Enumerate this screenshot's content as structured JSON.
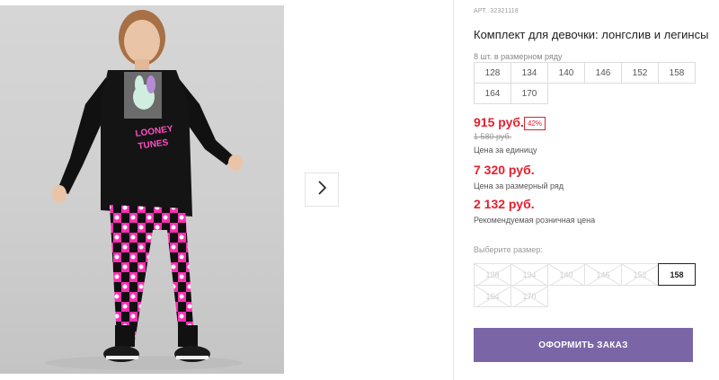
{
  "product": {
    "art_label": "АРТ.",
    "art_number": "32321118",
    "title": "Комплект для девочки: лонгслив и легинсы",
    "print_text_1": "LOONEY",
    "print_text_2": "TUNES"
  },
  "series": {
    "note": "8 шт. в размерном ряду",
    "sizes": [
      "128",
      "134",
      "140",
      "146",
      "152",
      "158",
      "164",
      "170"
    ]
  },
  "pricing": {
    "unit_price": "915 руб.",
    "discount": "42%",
    "old_price": "1 580 руб.",
    "unit_label": "Цена за единицу",
    "series_price": "7 320 руб.",
    "series_label": "Цена за размерный ряд",
    "retail_price": "2 132 руб.",
    "retail_label": "Рекомендуемая розничная цена"
  },
  "size_picker": {
    "label": "Выберите размер:",
    "options": [
      {
        "value": "128",
        "available": false
      },
      {
        "value": "134",
        "available": false
      },
      {
        "value": "140",
        "available": false
      },
      {
        "value": "146",
        "available": false
      },
      {
        "value": "152",
        "available": false
      },
      {
        "value": "158",
        "available": true,
        "selected": true
      },
      {
        "value": "164",
        "available": false
      },
      {
        "value": "170",
        "available": false
      }
    ]
  },
  "actions": {
    "order_label": "ОФОРМИТЬ ЗАКАЗ",
    "next_icon": "chevron-right-icon"
  },
  "colors": {
    "price_red": "#e3202f",
    "button_purple": "#7a66a7",
    "print_pink": "#ff2fb3"
  }
}
